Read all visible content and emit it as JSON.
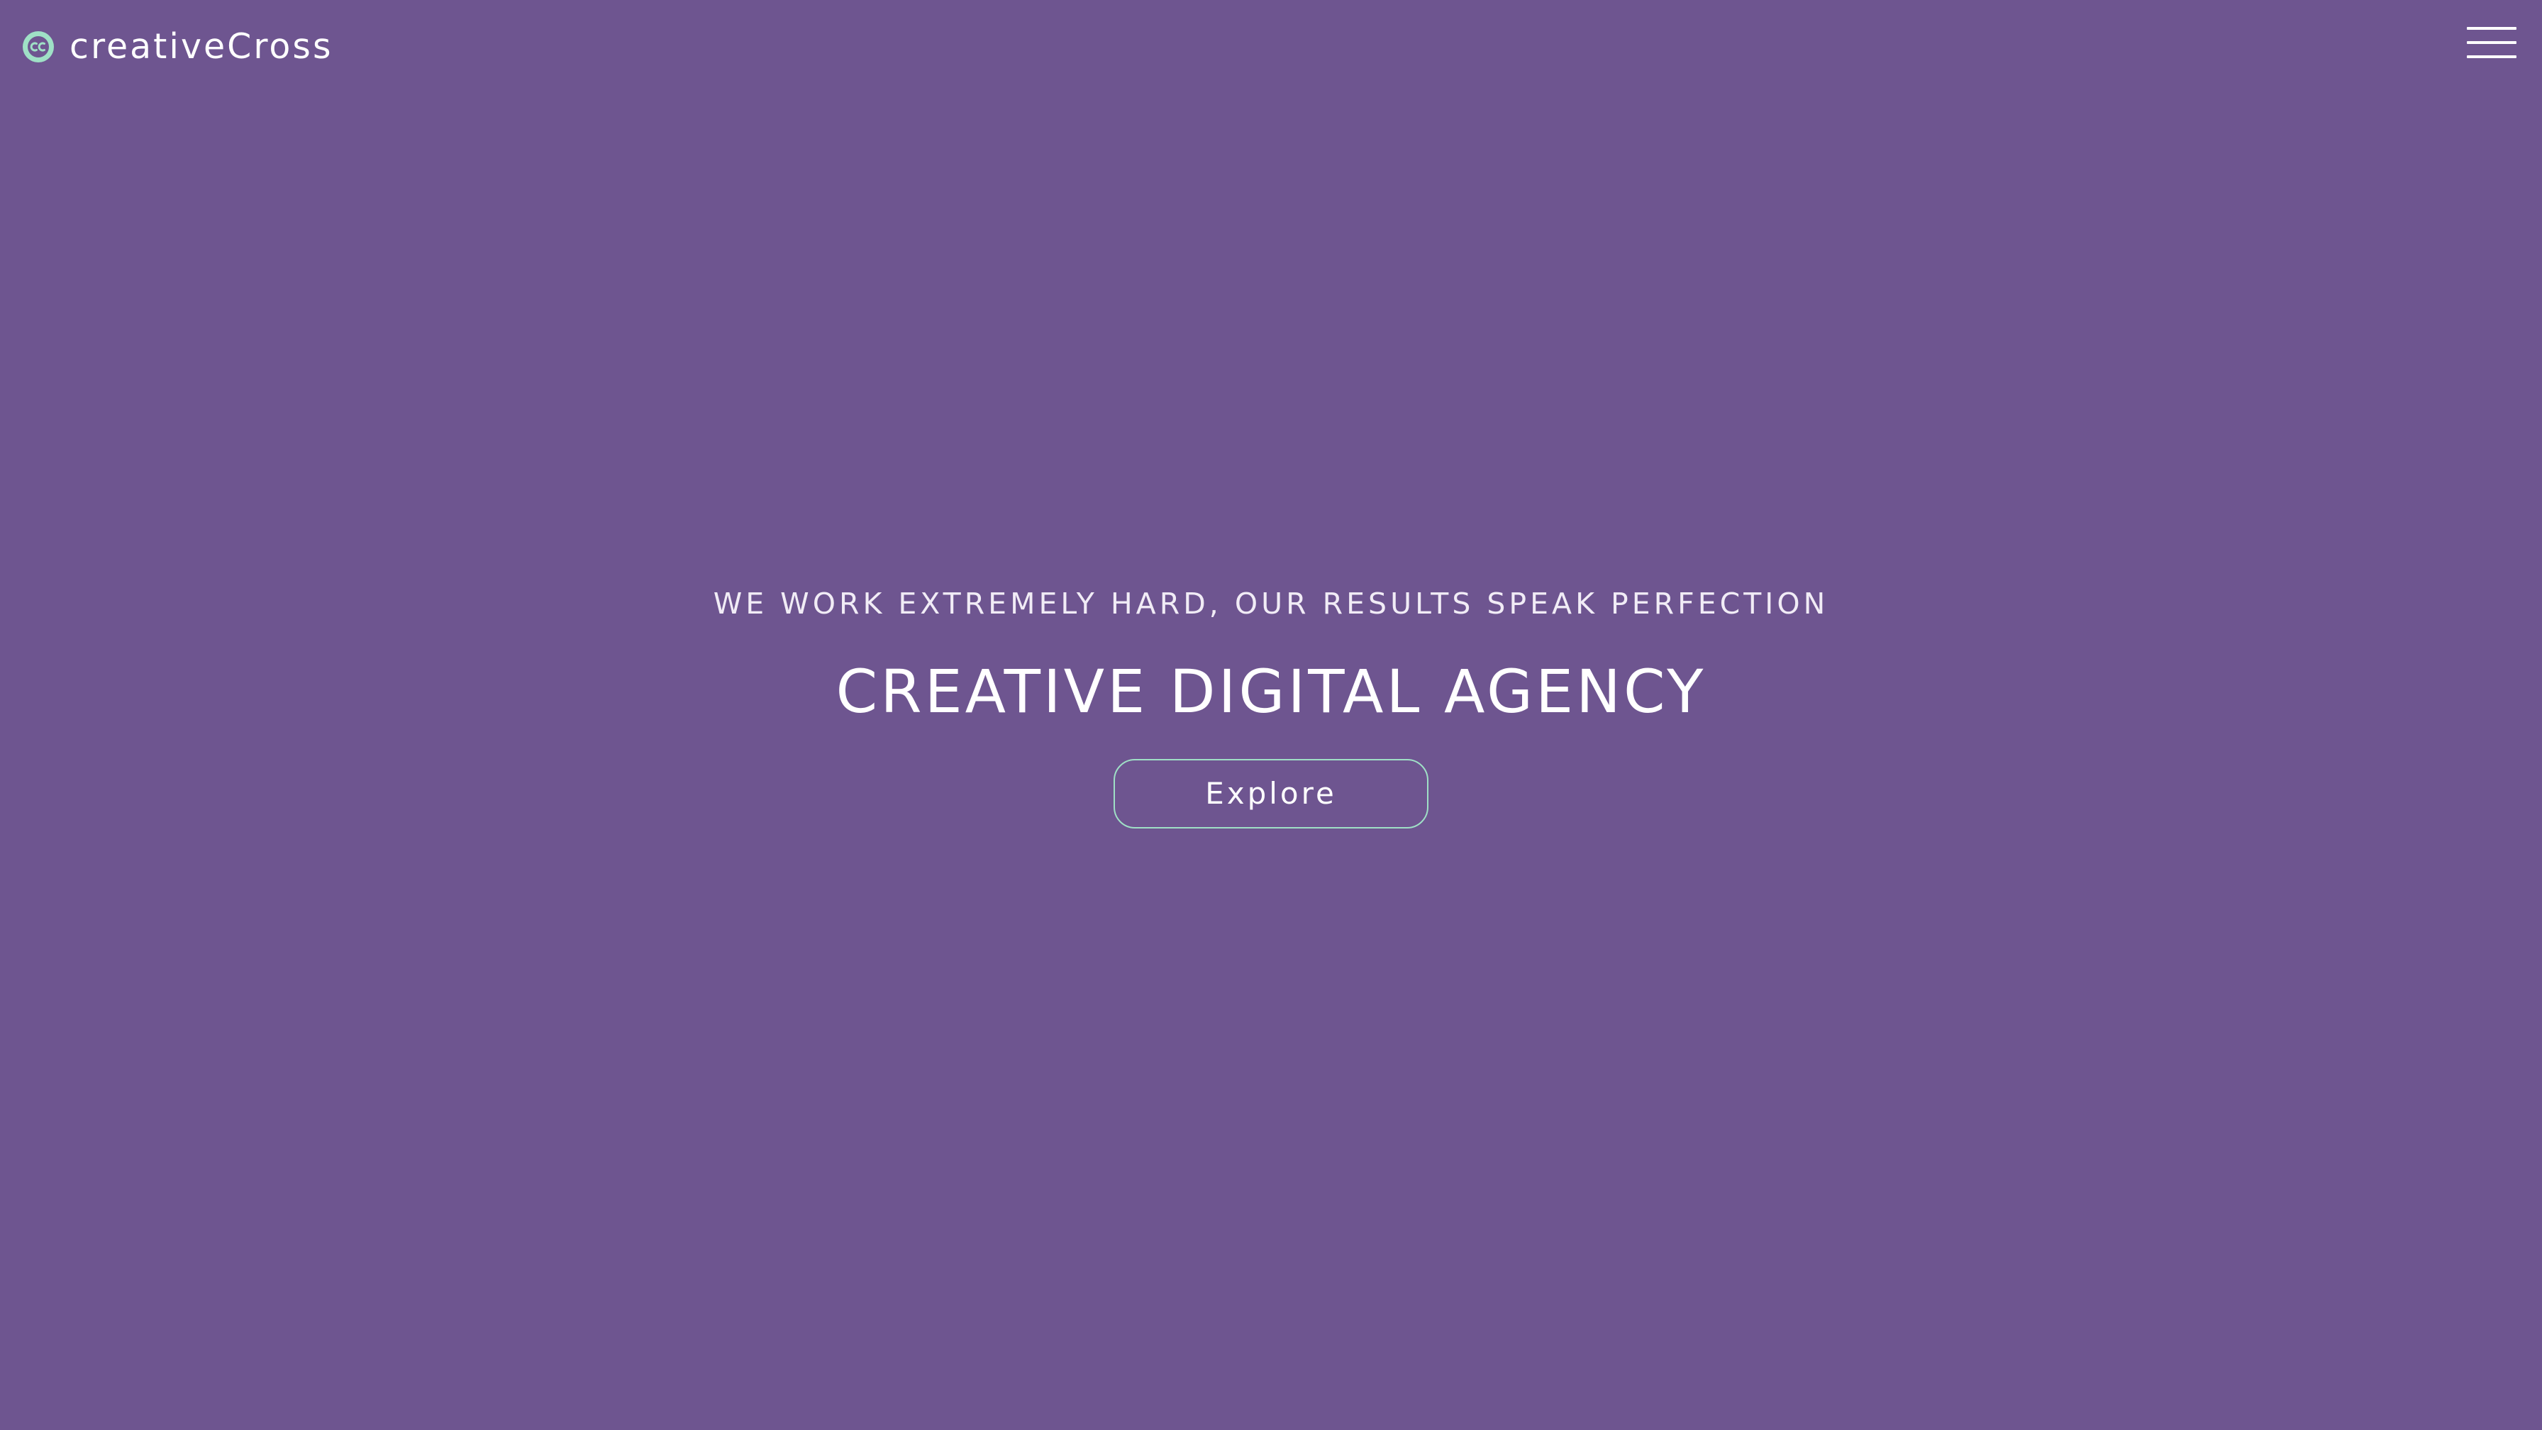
{
  "header": {
    "logo_text": "creativeCross",
    "logo_icon": "creative-commons-cc-icon",
    "menu_icon": "hamburger-menu-icon"
  },
  "hero": {
    "tagline": "WE WORK EXTREMELY HARD, OUR RESULTS SPEAK PERFECTION",
    "headline": "CREATIVE DIGITAL AGENCY",
    "cta_label": "Explore"
  },
  "colors": {
    "background": "#6e5590",
    "accent": "#9fe0c6",
    "text": "#ffffff"
  }
}
